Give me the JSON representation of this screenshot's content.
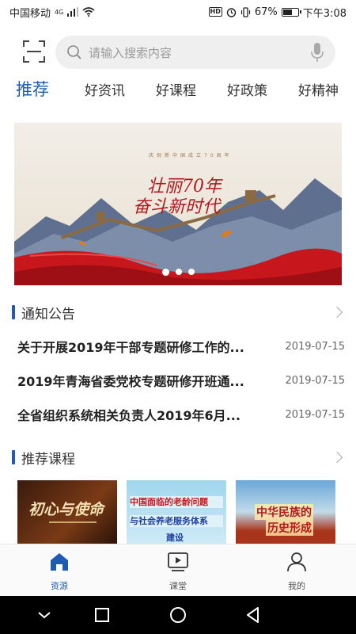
{
  "status_bar": {
    "carrier": "中国移动",
    "network": "4G",
    "battery": "67%",
    "battery_level": 0.67,
    "time": "下午3:08"
  },
  "search": {
    "placeholder": "请输入搜索内容"
  },
  "tabs": [
    {
      "label": "推荐",
      "active": true
    },
    {
      "label": "好资讯",
      "active": false
    },
    {
      "label": "好课程",
      "active": false
    },
    {
      "label": "好政策",
      "active": false
    },
    {
      "label": "好精神",
      "active": false
    }
  ],
  "banner": {
    "headline_line1": "壮丽70年",
    "headline_line2": "奋斗新时代",
    "small_text": "庆祝新中国成立70周年",
    "active_dot": 0,
    "dot_count": 3
  },
  "notices": {
    "title": "通知公告",
    "items": [
      {
        "title": "关于开展2019年干部专题研修工作的...",
        "date": "2019-07-15"
      },
      {
        "title": "2019年青海省委党校专题研修开班通...",
        "date": "2019-07-15"
      },
      {
        "title": "全省组织系统相关负责人2019年6月...",
        "date": "2019-07-15"
      }
    ]
  },
  "courses": {
    "title": "推荐课程",
    "items": [
      {
        "text_line1": "初心与使命",
        "text_line2": ""
      },
      {
        "text_line1": "中国面临的老龄问题",
        "text_line2": "与社会养老服务体系",
        "text_line3": "建设"
      },
      {
        "text_line1": "中华民族的",
        "text_line2": "历史形成"
      }
    ]
  },
  "bottom_nav": [
    {
      "label": "资源",
      "active": true
    },
    {
      "label": "课堂",
      "active": false
    },
    {
      "label": "我的",
      "active": false
    }
  ],
  "colors": {
    "accent": "#1e5bb5",
    "banner_red": "#b5181e"
  }
}
